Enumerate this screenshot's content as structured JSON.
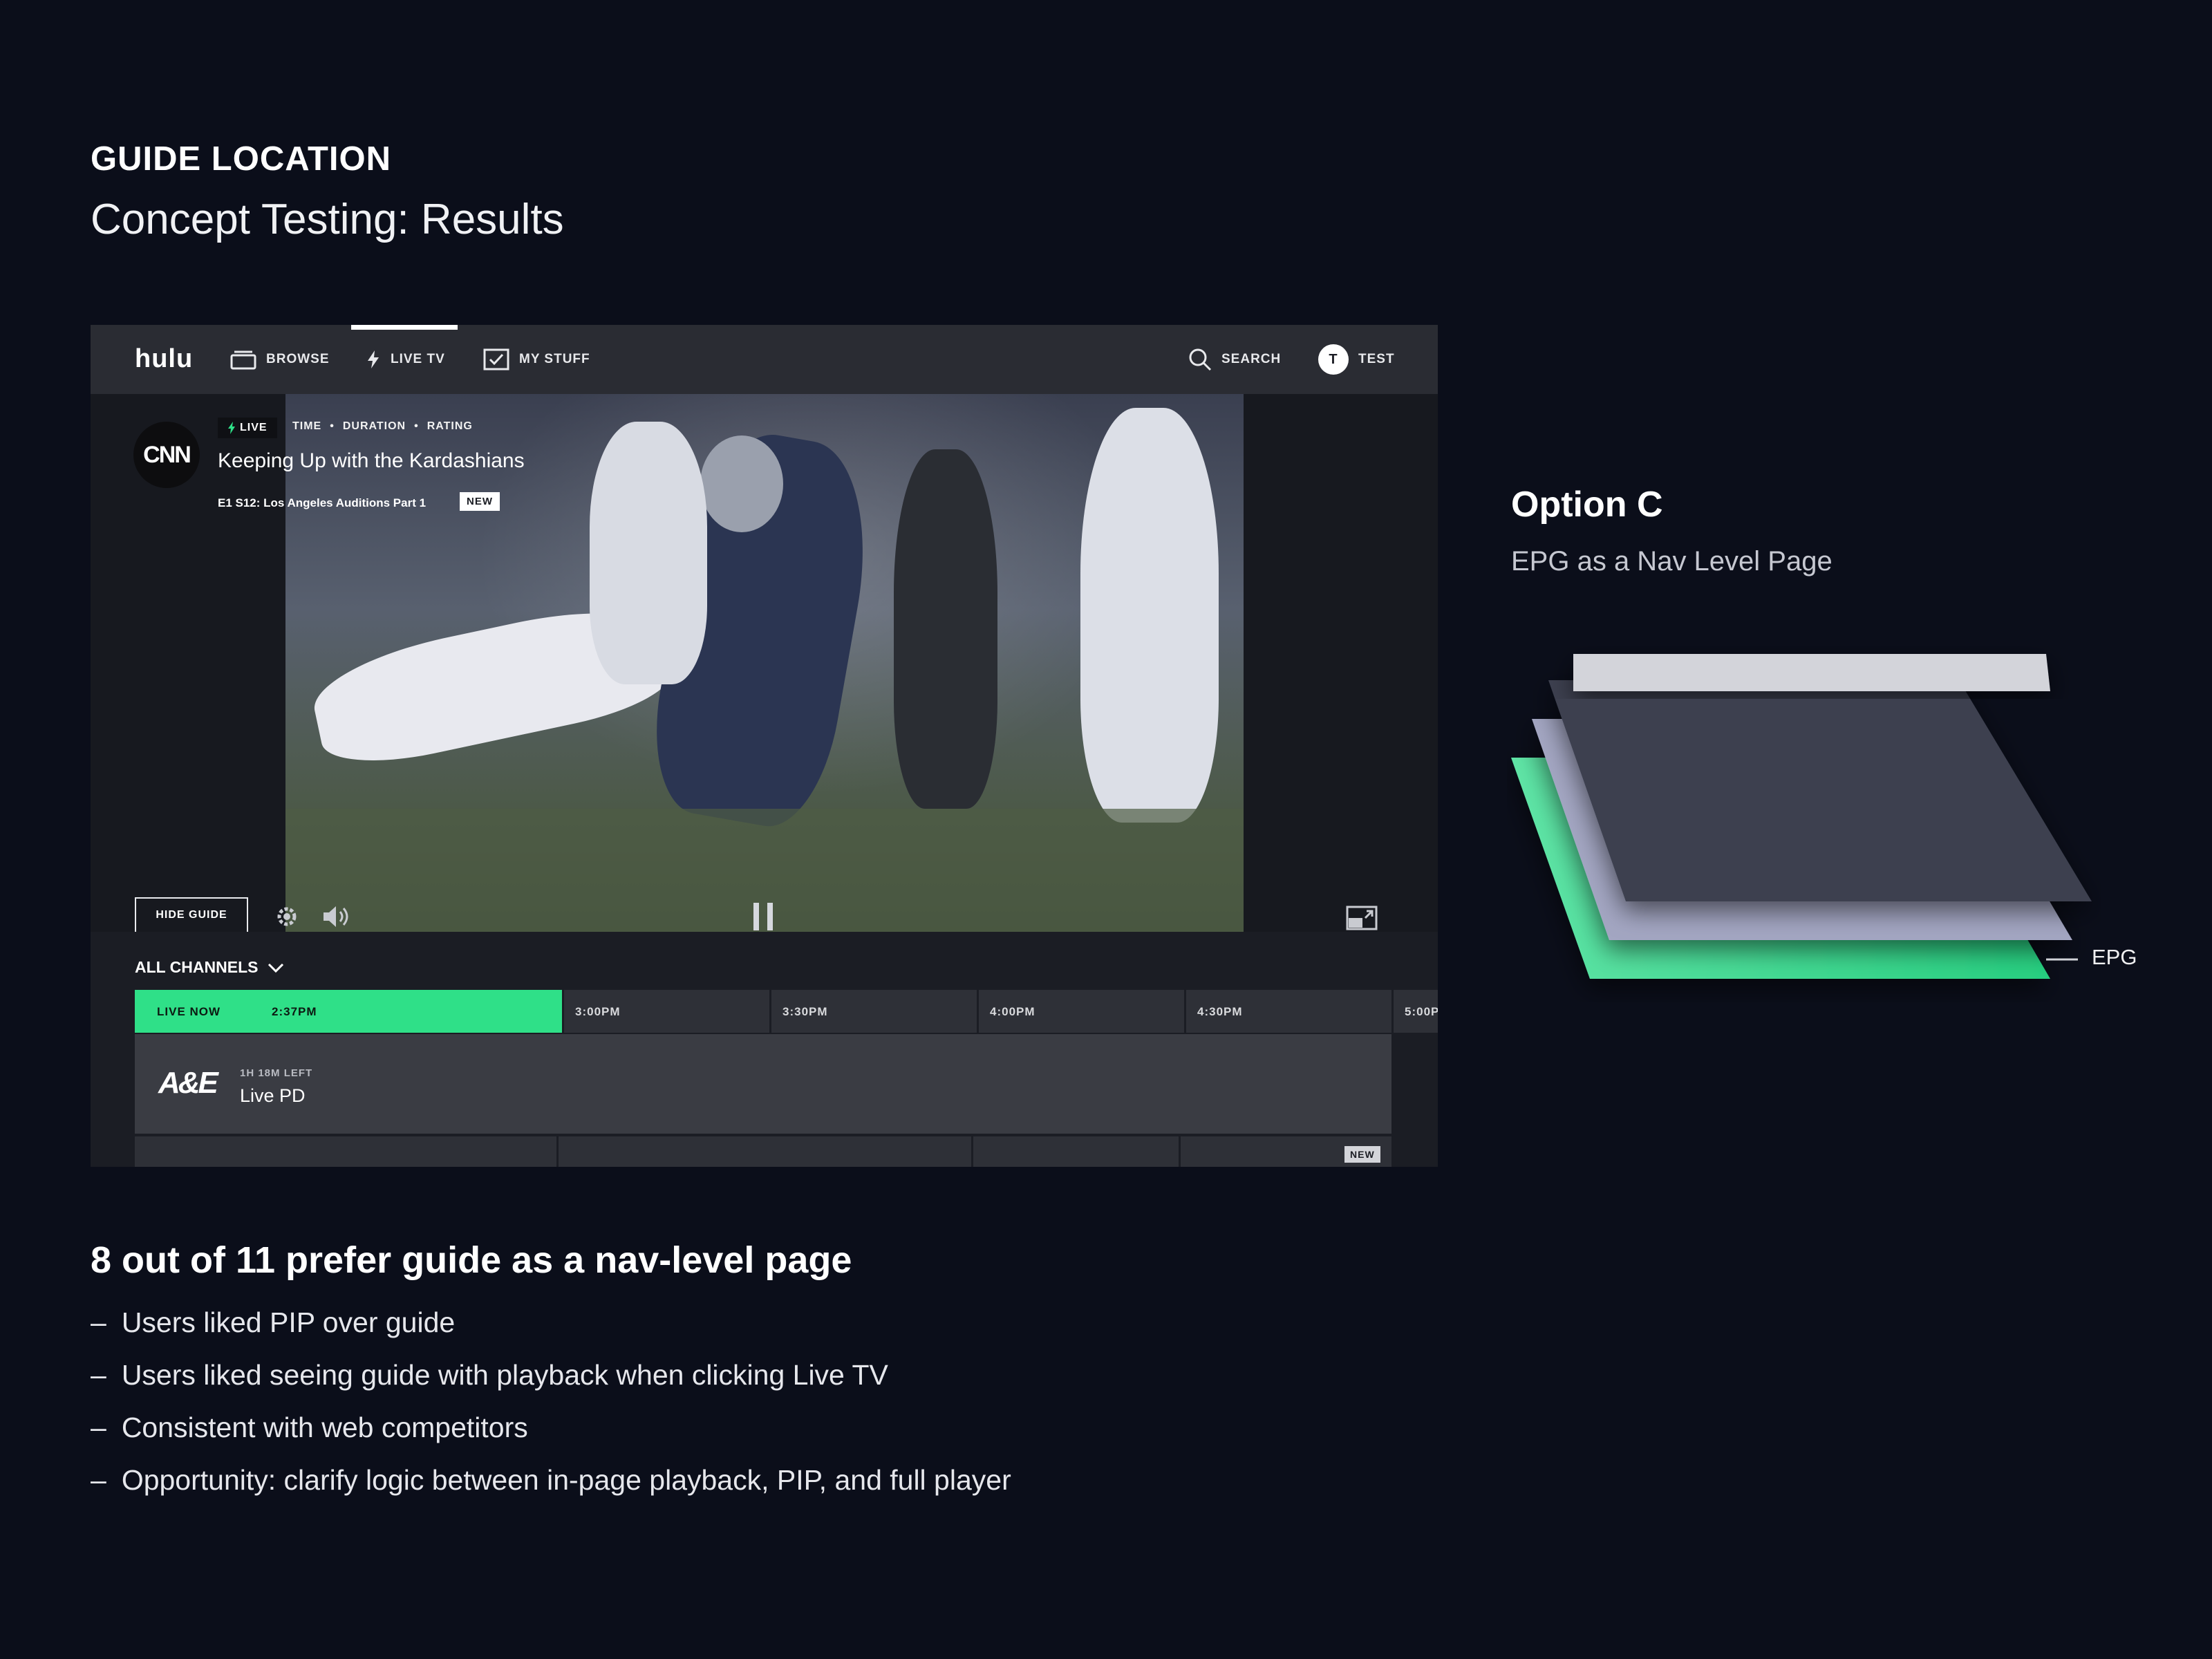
{
  "header": {
    "eyebrow": "GUIDE LOCATION",
    "subtitle": "Concept Testing: Results"
  },
  "app": {
    "logo": "hulu",
    "nav": [
      {
        "label": "BROWSE",
        "icon": "browse-icon"
      },
      {
        "label": "LIVE TV",
        "icon": "lightning-icon",
        "active": true
      },
      {
        "label": "MY STUFF",
        "icon": "checkbox-icon"
      }
    ],
    "search_label": "SEARCH",
    "profile": {
      "initial": "T",
      "name": "TEST"
    }
  },
  "now_playing": {
    "network": "CNN",
    "live_label": "LIVE",
    "meta": [
      "TIME",
      "DURATION",
      "RATING"
    ],
    "meta_separator": "•",
    "title": "Keeping Up with the Kardashians",
    "episode": "E1 S12:  Los Angeles Auditions Part 1",
    "badge": "NEW"
  },
  "controls": {
    "hide_guide": "HIDE GUIDE",
    "icons": [
      "gear-icon",
      "volume-icon",
      "pause-icon",
      "pip-icon"
    ]
  },
  "guide": {
    "filter": "ALL CHANNELS",
    "live_now": "LIVE NOW",
    "current_time": "2:37PM",
    "timeslots": [
      "3:00PM",
      "3:30PM",
      "4:00PM",
      "4:30PM",
      "5:00P"
    ],
    "rows": [
      {
        "network": "A&E",
        "remaining": "1H 18M LEFT",
        "program": "Live PD"
      }
    ],
    "next_row_badge": "NEW"
  },
  "option": {
    "title": "Option C",
    "subtitle": "EPG as a Nav Level Page",
    "layer_label": "EPG",
    "colors": {
      "top": "#d3d4da",
      "mid_dark": "#3d4050",
      "lilac": "#a3a6c2",
      "green": "#2ad486"
    }
  },
  "findings": {
    "title": "8 out of 11 prefer guide as a nav-level page",
    "items": [
      "Users liked PIP over guide",
      "Users liked seeing guide with playback when clicking Live TV",
      "Consistent with web competitors",
      "Opportunity: clarify logic between in-page playback, PIP, and full player"
    ]
  }
}
